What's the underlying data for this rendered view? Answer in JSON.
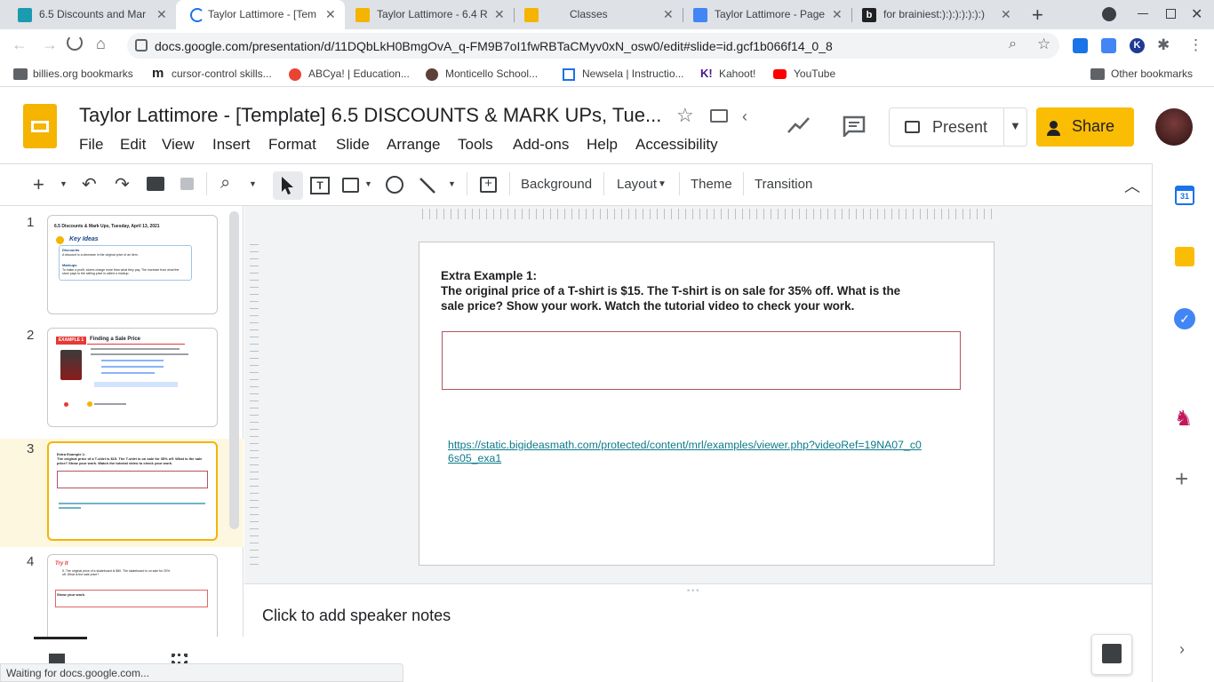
{
  "tabs": [
    {
      "title": "6.5 Discounts and Mar",
      "active": false
    },
    {
      "title": "Taylor Lattimore - [Temp",
      "active": true
    },
    {
      "title": "Taylor Lattimore - 6.4 R",
      "active": false
    },
    {
      "title": "Classes",
      "active": false
    },
    {
      "title": "Taylor Lattimore - Page",
      "active": false
    },
    {
      "title": "for brainiest:):):):):):):)",
      "active": false
    }
  ],
  "browser": {
    "url": "docs.google.com/presentation/d/11DQbLkH0BmgOvA_q-FM9B7oI1fwRBTaCMyv0xN_osw0/edit#slide=id.gcf1b066f14_0_8",
    "bookmarks": [
      "billies.org bookmarks",
      "cursor-control skills...",
      "ABCya! | Education...",
      "Monticello School...",
      "Newsela | Instructio...",
      "Kahoot!",
      "YouTube"
    ],
    "other_bookmarks": "Other bookmarks",
    "status": "Waiting for docs.google.com..."
  },
  "doc": {
    "title": "Taylor Lattimore - [Template] 6.5 DISCOUNTS & MARK UPs, Tue...",
    "menu": [
      "File",
      "Edit",
      "View",
      "Insert",
      "Format",
      "Slide",
      "Arrange",
      "Tools",
      "Add-ons",
      "Help",
      "Accessibility"
    ],
    "present_label": "Present",
    "share_label": "Share"
  },
  "toolbar": {
    "background": "Background",
    "layout": "Layout",
    "theme": "Theme",
    "transition": "Transition"
  },
  "filmstrip": {
    "numbers": [
      "1",
      "2",
      "3",
      "4"
    ],
    "s1_title": "6.5 Discounts & Mark Ups, Tuesday, April 13, 2021",
    "s1_key": "Key Ideas",
    "s1_disc": "Discounts",
    "s1_disc_text": "A discount is a decrease in the original price of an item.",
    "s1_mark": "Markups",
    "s1_mark_text": "To make a profit, stores charge more than what they pay. The increase from what the store pays to the selling price is called a markup.",
    "s2_badge": "EXAMPLE 1",
    "s2_title": "Finding a Sale Price",
    "s3_line1": "Extra Example 1:",
    "s3_line2": "The original price of a T-shirt is $15. The T-shirt is on sale for 35% off. What is the sale price? Show your work. Watch the tutorial video to check your work.",
    "s4_try": "Try It",
    "s4_text": "5. The original price of a skateboard is $50. The skateboard is on sale for 20% off. What is the sale price?",
    "s4_show": "Show your work."
  },
  "slide": {
    "heading": "Extra Example 1:",
    "body_line1": "The original price of a T-shirt is $15.  The T-shirt is on sale for 35% off.   What is the",
    "body_line2": "sale price?  Show your work.  Watch the tutorial video to check your work.",
    "link_line1": "https://static.bigideasmath.com/protected/content/mrl/examples/viewer.php?videoRef=19NA07_c0",
    "link_line2": "6s05_exa1"
  },
  "notes": {
    "placeholder": "Click to add speaker notes"
  },
  "colors": {
    "accent": "#fbbc04",
    "link": "#1a73e8",
    "selected": "#f4b400",
    "box_border": "#b2545e"
  }
}
